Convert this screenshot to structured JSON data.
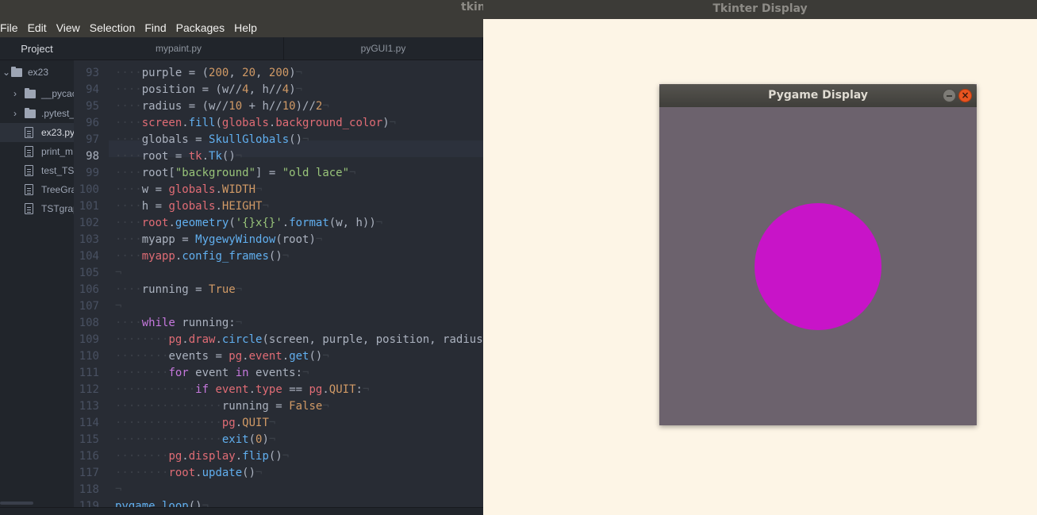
{
  "editor": {
    "window_title": "tkin",
    "menu": [
      "File",
      "Edit",
      "View",
      "Selection",
      "Find",
      "Packages",
      "Help"
    ],
    "tree": {
      "tab_label": "Project",
      "root": "ex23",
      "items": [
        {
          "label": "__pycac",
          "type": "folder"
        },
        {
          "label": ".pytest_",
          "type": "folder"
        },
        {
          "label": "ex23.py",
          "type": "file",
          "selected": true
        },
        {
          "label": "print_m",
          "type": "file"
        },
        {
          "label": "test_TS",
          "type": "file"
        },
        {
          "label": "TreeGra",
          "type": "file"
        },
        {
          "label": "TSTgrap",
          "type": "file"
        }
      ]
    },
    "tabs": [
      "mypaint.py",
      "pyGUI1.py"
    ],
    "current_line": 98,
    "lines": [
      {
        "n": 93,
        "tokens": [
          [
            "ws",
            "····"
          ],
          [
            "",
            "purple = ("
          ],
          [
            "num",
            "200"
          ],
          [
            "",
            ", "
          ],
          [
            "num",
            "20"
          ],
          [
            "",
            ", "
          ],
          [
            "num",
            "200"
          ],
          [
            "",
            ")"
          ],
          [
            "ws",
            "¬"
          ]
        ]
      },
      {
        "n": 94,
        "tokens": [
          [
            "ws",
            "····"
          ],
          [
            "",
            "position = (w//"
          ],
          [
            "num",
            "4"
          ],
          [
            "",
            ", h//"
          ],
          [
            "num",
            "4"
          ],
          [
            "",
            ")"
          ],
          [
            "ws",
            "¬"
          ]
        ]
      },
      {
        "n": 95,
        "tokens": [
          [
            "ws",
            "····"
          ],
          [
            "",
            "radius = (w//"
          ],
          [
            "num",
            "10"
          ],
          [
            "",
            " + h//"
          ],
          [
            "num",
            "10"
          ],
          [
            "",
            ")//"
          ],
          [
            "num",
            "2"
          ],
          [
            "ws",
            "¬"
          ]
        ]
      },
      {
        "n": 96,
        "tokens": [
          [
            "ws",
            "····"
          ],
          [
            "var",
            "screen"
          ],
          [
            "",
            "."
          ],
          [
            "fn",
            "fill"
          ],
          [
            "",
            "("
          ],
          [
            "var",
            "globals"
          ],
          [
            "",
            "."
          ],
          [
            "var",
            "background_color"
          ],
          [
            "",
            ")"
          ],
          [
            "ws",
            "¬"
          ]
        ]
      },
      {
        "n": 97,
        "tokens": [
          [
            "ws",
            "····"
          ],
          [
            "",
            "globals = "
          ],
          [
            "fn",
            "SkullGlobals"
          ],
          [
            "",
            "()"
          ],
          [
            "ws",
            "¬"
          ]
        ]
      },
      {
        "n": 98,
        "tokens": [
          [
            "ws",
            "····"
          ],
          [
            "",
            "root = "
          ],
          [
            "var",
            "tk"
          ],
          [
            "",
            "."
          ],
          [
            "fn",
            "Tk"
          ],
          [
            "",
            "()"
          ],
          [
            "ws",
            "¬"
          ]
        ]
      },
      {
        "n": 99,
        "tokens": [
          [
            "ws",
            "····"
          ],
          [
            "",
            "root["
          ],
          [
            "str",
            "\"background\""
          ],
          [
            "",
            "] = "
          ],
          [
            "str",
            "\"old lace\""
          ],
          [
            "ws",
            "¬"
          ]
        ]
      },
      {
        "n": 100,
        "tokens": [
          [
            "ws",
            "····"
          ],
          [
            "",
            "w = "
          ],
          [
            "var",
            "globals"
          ],
          [
            "",
            "."
          ],
          [
            "num",
            "WIDTH"
          ],
          [
            "ws",
            "¬"
          ]
        ]
      },
      {
        "n": 101,
        "tokens": [
          [
            "ws",
            "····"
          ],
          [
            "",
            "h = "
          ],
          [
            "var",
            "globals"
          ],
          [
            "",
            "."
          ],
          [
            "num",
            "HEIGHT"
          ],
          [
            "ws",
            "¬"
          ]
        ]
      },
      {
        "n": 102,
        "tokens": [
          [
            "ws",
            "····"
          ],
          [
            "var",
            "root"
          ],
          [
            "",
            "."
          ],
          [
            "fn",
            "geometry"
          ],
          [
            "",
            "("
          ],
          [
            "str",
            "'{}x{}'"
          ],
          [
            "",
            "."
          ],
          [
            "fn",
            "format"
          ],
          [
            "",
            "(w, h))"
          ],
          [
            "ws",
            "¬"
          ]
        ]
      },
      {
        "n": 103,
        "tokens": [
          [
            "ws",
            "····"
          ],
          [
            "",
            "myapp = "
          ],
          [
            "fn",
            "MygewyWindow"
          ],
          [
            "",
            "(root)"
          ],
          [
            "ws",
            "¬"
          ]
        ]
      },
      {
        "n": 104,
        "tokens": [
          [
            "ws",
            "····"
          ],
          [
            "var",
            "myapp"
          ],
          [
            "",
            "."
          ],
          [
            "fn",
            "config_frames"
          ],
          [
            "",
            "()"
          ],
          [
            "ws",
            "¬"
          ]
        ]
      },
      {
        "n": 105,
        "tokens": [
          [
            "ws",
            "¬"
          ]
        ]
      },
      {
        "n": 106,
        "tokens": [
          [
            "ws",
            "····"
          ],
          [
            "",
            "running = "
          ],
          [
            "bool",
            "True"
          ],
          [
            "ws",
            "¬"
          ]
        ]
      },
      {
        "n": 107,
        "tokens": [
          [
            "ws",
            "¬"
          ]
        ]
      },
      {
        "n": 108,
        "tokens": [
          [
            "ws",
            "····"
          ],
          [
            "kw",
            "while"
          ],
          [
            "",
            " running:"
          ],
          [
            "ws",
            "¬"
          ]
        ]
      },
      {
        "n": 109,
        "tokens": [
          [
            "ws",
            "········"
          ],
          [
            "var",
            "pg"
          ],
          [
            "",
            "."
          ],
          [
            "var",
            "draw"
          ],
          [
            "",
            "."
          ],
          [
            "fn",
            "circle"
          ],
          [
            "",
            "(screen, purple, position, radius"
          ]
        ]
      },
      {
        "n": 110,
        "tokens": [
          [
            "ws",
            "········"
          ],
          [
            "",
            "events = "
          ],
          [
            "var",
            "pg"
          ],
          [
            "",
            "."
          ],
          [
            "var",
            "event"
          ],
          [
            "",
            "."
          ],
          [
            "fn",
            "get"
          ],
          [
            "",
            "()"
          ],
          [
            "ws",
            "¬"
          ]
        ]
      },
      {
        "n": 111,
        "tokens": [
          [
            "ws",
            "········"
          ],
          [
            "kw",
            "for"
          ],
          [
            "",
            " event "
          ],
          [
            "kw",
            "in"
          ],
          [
            "",
            " events:"
          ],
          [
            "ws",
            "¬"
          ]
        ]
      },
      {
        "n": 112,
        "tokens": [
          [
            "ws",
            "············"
          ],
          [
            "kw",
            "if"
          ],
          [
            "",
            " "
          ],
          [
            "var",
            "event"
          ],
          [
            "",
            "."
          ],
          [
            "var",
            "type"
          ],
          [
            "",
            " == "
          ],
          [
            "var",
            "pg"
          ],
          [
            "",
            "."
          ],
          [
            "num",
            "QUIT"
          ],
          [
            "",
            ":"
          ],
          [
            "ws",
            "¬"
          ]
        ]
      },
      {
        "n": 113,
        "tokens": [
          [
            "ws",
            "················"
          ],
          [
            "",
            "running = "
          ],
          [
            "bool",
            "False"
          ],
          [
            "ws",
            "¬"
          ]
        ]
      },
      {
        "n": 114,
        "tokens": [
          [
            "ws",
            "················"
          ],
          [
            "var",
            "pg"
          ],
          [
            "",
            "."
          ],
          [
            "num",
            "QUIT"
          ],
          [
            "ws",
            "¬"
          ]
        ]
      },
      {
        "n": 115,
        "tokens": [
          [
            "ws",
            "················"
          ],
          [
            "fn",
            "exit"
          ],
          [
            "",
            "("
          ],
          [
            "num",
            "0"
          ],
          [
            "",
            ")"
          ],
          [
            "ws",
            "¬"
          ]
        ]
      },
      {
        "n": 116,
        "tokens": [
          [
            "ws",
            "········"
          ],
          [
            "var",
            "pg"
          ],
          [
            "",
            "."
          ],
          [
            "var",
            "display"
          ],
          [
            "",
            "."
          ],
          [
            "fn",
            "flip"
          ],
          [
            "",
            "()"
          ],
          [
            "ws",
            "¬"
          ]
        ]
      },
      {
        "n": 117,
        "tokens": [
          [
            "ws",
            "········"
          ],
          [
            "var",
            "root"
          ],
          [
            "",
            "."
          ],
          [
            "fn",
            "update"
          ],
          [
            "",
            "()"
          ],
          [
            "ws",
            "¬"
          ]
        ]
      },
      {
        "n": 118,
        "tokens": [
          [
            "ws",
            "¬"
          ]
        ]
      },
      {
        "n": 119,
        "tokens": [
          [
            "fn",
            "pygame_loop"
          ],
          [
            "",
            "()"
          ],
          [
            "ws",
            "¬"
          ]
        ]
      }
    ]
  },
  "tkinter": {
    "window_title": "Tkinter Display",
    "background": "#fdf5e6"
  },
  "pygame": {
    "window_title": "Pygame Display",
    "close_glyph": "×",
    "background": "#6c626d",
    "circle_color": "#c814c8"
  }
}
